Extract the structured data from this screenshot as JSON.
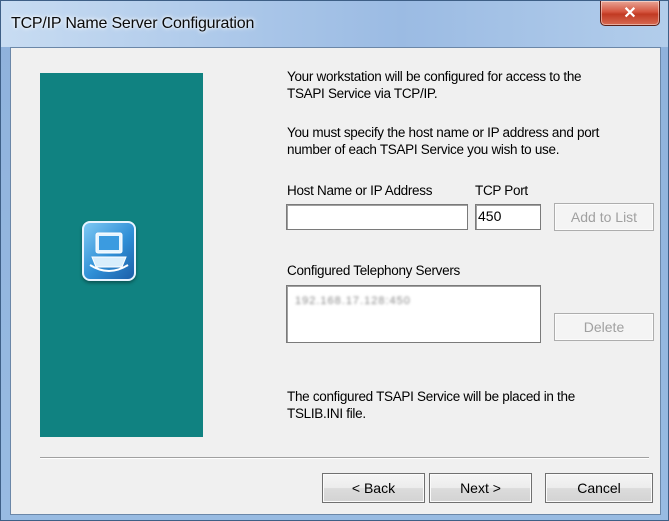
{
  "window": {
    "title": "TCP/IP Name Server Configuration",
    "close_glyph": "✕"
  },
  "intro": {
    "line1": "Your workstation will be configured for access to the",
    "line2": "TSAPI Service via TCP/IP.",
    "line3": "You must specify the host name or IP address and port",
    "line4": "number of each TSAPI Service you wish to use."
  },
  "form": {
    "host_label": "Host Name or IP Address",
    "host_value": "",
    "port_label": "TCP Port",
    "port_value": "450",
    "add_button_label": "Add to List",
    "servers_label": "Configured Telephony Servers",
    "servers": [
      "192.168.17.128:450"
    ],
    "delete_button_label": "Delete"
  },
  "footer_note": {
    "line1": "The configured TSAPI Service will be placed in the",
    "line2": "TSLIB.INI file."
  },
  "buttons": {
    "back_label": "< Back",
    "next_label": "Next >",
    "cancel_label": "Cancel"
  },
  "colors": {
    "side_panel": "#108281",
    "close_button": "#c9452d"
  }
}
